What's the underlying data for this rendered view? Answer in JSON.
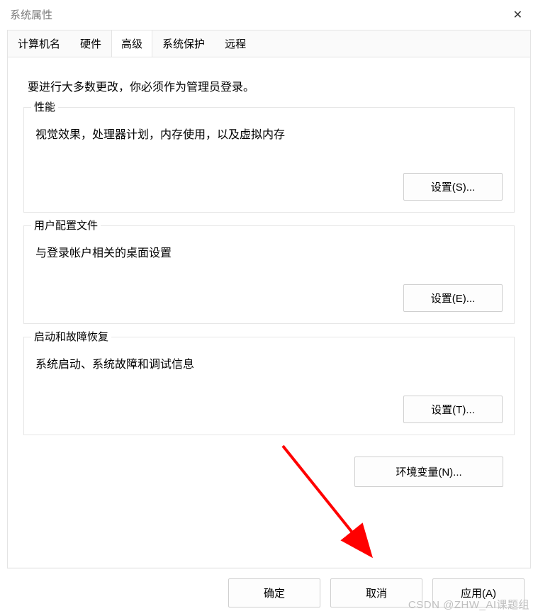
{
  "window": {
    "title": "系统属性",
    "close_glyph": "✕"
  },
  "tabs": {
    "computer_name": "计算机名",
    "hardware": "硬件",
    "advanced": "高级",
    "system_protection": "系统保护",
    "remote": "远程"
  },
  "advanced_tab": {
    "intro": "要进行大多数更改，你必须作为管理员登录。",
    "performance": {
      "legend": "性能",
      "desc": "视觉效果，处理器计划，内存使用，以及虚拟内存",
      "button": "设置(S)..."
    },
    "user_profiles": {
      "legend": "用户配置文件",
      "desc": "与登录帐户相关的桌面设置",
      "button": "设置(E)..."
    },
    "startup_recovery": {
      "legend": "启动和故障恢复",
      "desc": "系统启动、系统故障和调试信息",
      "button": "设置(T)..."
    },
    "env_button": "环境变量(N)..."
  },
  "footer": {
    "ok": "确定",
    "cancel": "取消",
    "apply": "应用(A)"
  },
  "watermark": "CSDN @ZHW_AI课题组"
}
